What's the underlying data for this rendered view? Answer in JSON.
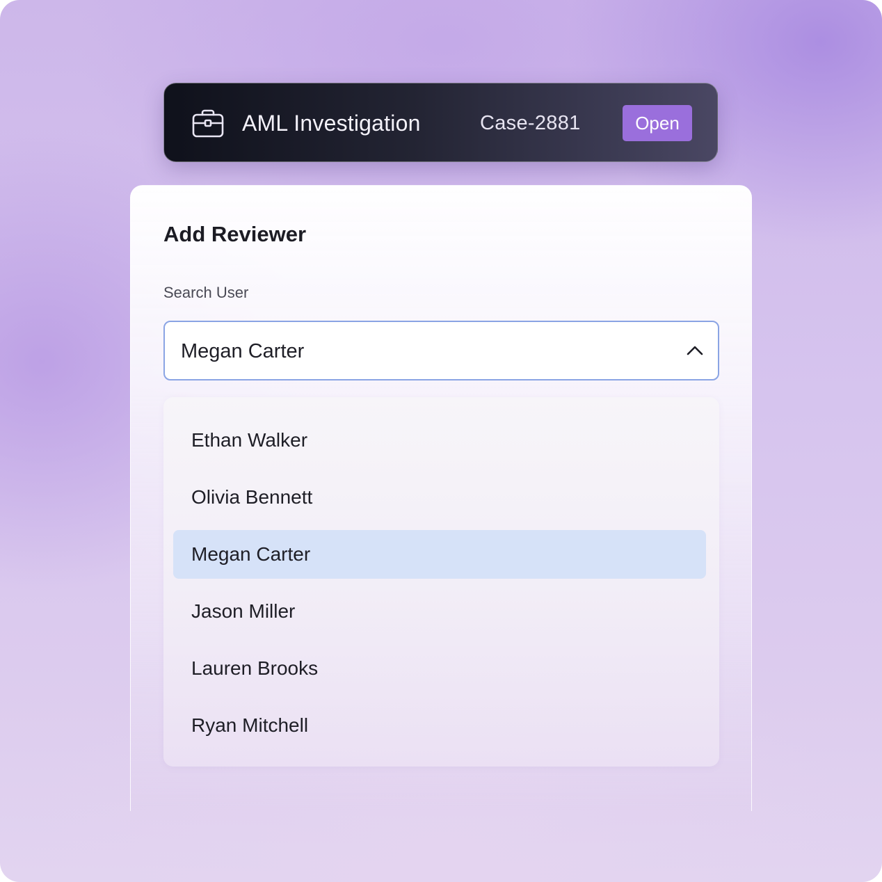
{
  "header": {
    "icon": "briefcase-icon",
    "title": "AML Investigation",
    "case_id": "Case-2881",
    "status": "Open",
    "status_color": "#9a6fdc"
  },
  "reviewer_panel": {
    "title": "Add Reviewer",
    "search_label": "Search User",
    "selected_value": "Megan Carter",
    "chevron_icon": "chevron-up-icon",
    "options": [
      {
        "label": "Ethan Walker",
        "selected": false
      },
      {
        "label": "Olivia Bennett",
        "selected": false
      },
      {
        "label": "Megan Carter",
        "selected": true
      },
      {
        "label": "Jason Miller",
        "selected": false
      },
      {
        "label": "Lauren Brooks",
        "selected": false
      },
      {
        "label": "Ryan Mitchell",
        "selected": false
      }
    ],
    "selected_highlight_color": "#d6e2f8",
    "focus_border_color": "#8aa4e4"
  }
}
